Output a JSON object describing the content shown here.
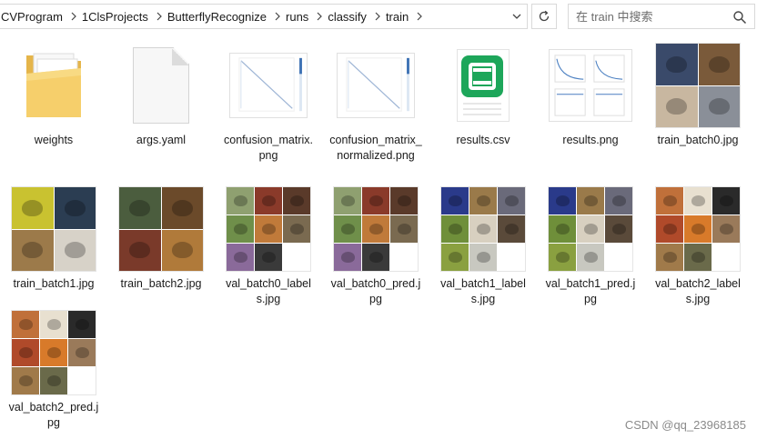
{
  "address_bar": {
    "crumbs": [
      "CVProgram",
      "1ClsProjects",
      "ButterflyRecognize",
      "runs",
      "classify",
      "train"
    ]
  },
  "search": {
    "placeholder": "在 train 中搜索"
  },
  "files": [
    {
      "name": "weights",
      "kind": "folder"
    },
    {
      "name": "args.yaml",
      "kind": "document"
    },
    {
      "name": "confusion_matrix.png",
      "kind": "confusion-matrix-image"
    },
    {
      "name": "confusion_matrix_normalized.png",
      "kind": "confusion-matrix-image"
    },
    {
      "name": "results.csv",
      "kind": "spreadsheet"
    },
    {
      "name": "results.png",
      "kind": "plot-image"
    },
    {
      "name": "train_batch0.jpg",
      "kind": "photo-mosaic-2x2"
    },
    {
      "name": "train_batch1.jpg",
      "kind": "photo-mosaic-2x2"
    },
    {
      "name": "train_batch2.jpg",
      "kind": "photo-mosaic-2x2"
    },
    {
      "name": "val_batch0_labels.jpg",
      "kind": "photo-mosaic-3x3"
    },
    {
      "name": "val_batch0_pred.jpg",
      "kind": "photo-mosaic-3x3"
    },
    {
      "name": "val_batch1_labels.jpg",
      "kind": "photo-mosaic-3x3"
    },
    {
      "name": "val_batch1_pred.jpg",
      "kind": "photo-mosaic-3x3"
    },
    {
      "name": "val_batch2_labels.jpg",
      "kind": "photo-mosaic-3x3"
    },
    {
      "name": "val_batch2_pred.jpg",
      "kind": "photo-mosaic-3x3"
    }
  ],
  "watermark": "CSDN @qq_23968185"
}
